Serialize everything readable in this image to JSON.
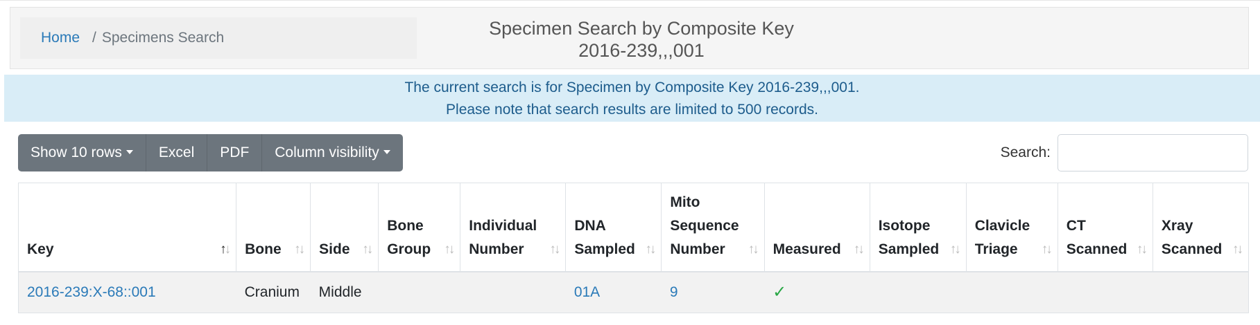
{
  "breadcrumb": {
    "home": "Home",
    "separator": "/",
    "current": "Specimens Search"
  },
  "page_title": {
    "line1": "Specimen Search by Composite Key",
    "line2": "2016-239,,,001"
  },
  "alert": {
    "line1": "The current search is for Specimen by Composite Key 2016-239,,,001.",
    "line2": "Please note that search results are limited to 500 records."
  },
  "toolbar": {
    "show_rows": "Show 10 rows",
    "excel": "Excel",
    "pdf": "PDF",
    "column_visibility": "Column visibility"
  },
  "search": {
    "label": "Search:",
    "value": "",
    "placeholder": ""
  },
  "table": {
    "headers": [
      {
        "l1": "",
        "l2": "",
        "l3": "Key"
      },
      {
        "l1": "",
        "l2": "",
        "l3": "Bone"
      },
      {
        "l1": "",
        "l2": "",
        "l3": "Side"
      },
      {
        "l1": "",
        "l2": "Bone",
        "l3": "Group"
      },
      {
        "l1": "",
        "l2": "Individual",
        "l3": "Number"
      },
      {
        "l1": "",
        "l2": "DNA",
        "l3": "Sampled"
      },
      {
        "l1": "Mito",
        "l2": "Sequence",
        "l3": "Number"
      },
      {
        "l1": "",
        "l2": "",
        "l3": "Measured"
      },
      {
        "l1": "",
        "l2": "Isotope",
        "l3": "Sampled"
      },
      {
        "l1": "",
        "l2": "Clavicle",
        "l3": "Triage"
      },
      {
        "l1": "",
        "l2": "CT",
        "l3": "Scanned"
      },
      {
        "l1": "",
        "l2": "Xray",
        "l3": "Scanned"
      }
    ],
    "rows": [
      {
        "key": "2016-239:X-68::001",
        "bone": "Cranium",
        "side": "Middle",
        "bone_group": "",
        "individual_number": "",
        "dna_sampled": "01A",
        "mito_sequence_number": "9",
        "measured": "✓",
        "isotope_sampled": "",
        "clavicle_triage": "",
        "ct_scanned": "",
        "xray_scanned": ""
      }
    ]
  },
  "colors": {
    "link": "#2a7ab8",
    "alert_bg": "#d9edf7",
    "alert_text": "#1d5c8c",
    "button_bg": "#6c757d",
    "check": "#28a745"
  }
}
